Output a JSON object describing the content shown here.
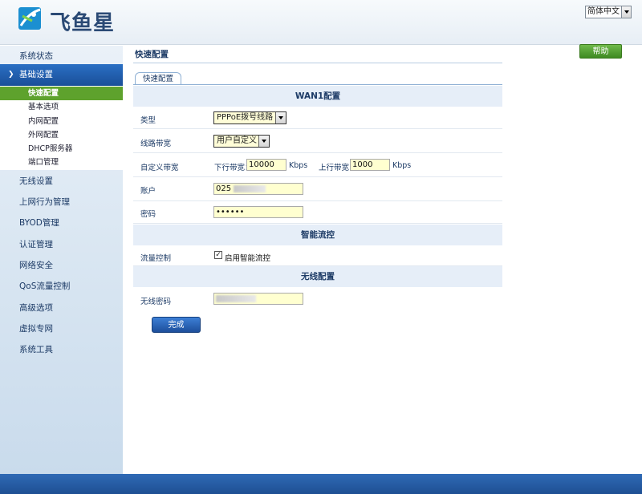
{
  "header": {
    "logo_text": "飞鱼星",
    "language": "简体中文"
  },
  "sidebar": {
    "items": [
      {
        "label": "系统状态"
      },
      {
        "label": "基础设置"
      },
      {
        "label": "无线设置"
      },
      {
        "label": "上网行为管理"
      },
      {
        "label": "BYOD管理"
      },
      {
        "label": "认证管理"
      },
      {
        "label": "网络安全"
      },
      {
        "label": "QoS流量控制"
      },
      {
        "label": "高级选项"
      },
      {
        "label": "虚拟专网"
      },
      {
        "label": "系统工具"
      }
    ],
    "sub_items": [
      {
        "label": "快速配置"
      },
      {
        "label": "基本选项"
      },
      {
        "label": "内网配置"
      },
      {
        "label": "外网配置"
      },
      {
        "label": "DHCP服务器"
      },
      {
        "label": "端口管理"
      }
    ]
  },
  "main": {
    "page_title": "快速配置",
    "help_label": "帮助",
    "tab_label": "快速配置",
    "wan_section": {
      "title": "WAN1配置",
      "type_label": "类型",
      "type_value": "PPPoE拨号线路",
      "bandwidth_label": "线路带宽",
      "bandwidth_value": "用户自定义",
      "custom_label": "自定义带宽",
      "down_label": "下行带宽：",
      "down_value": "10000",
      "down_unit": "Kbps",
      "up_label": "上行带宽：",
      "up_value": "1000",
      "up_unit": "Kbps",
      "account_label": "账户",
      "account_value": "025",
      "password_label": "密码",
      "password_value": "••••••"
    },
    "flow_section": {
      "title": "智能流控",
      "label": "流量控制",
      "checkbox_label": "启用智能流控",
      "checked": true
    },
    "wireless_section": {
      "title": "无线配置",
      "password_label": "无线密码"
    },
    "done_label": "完成"
  }
}
